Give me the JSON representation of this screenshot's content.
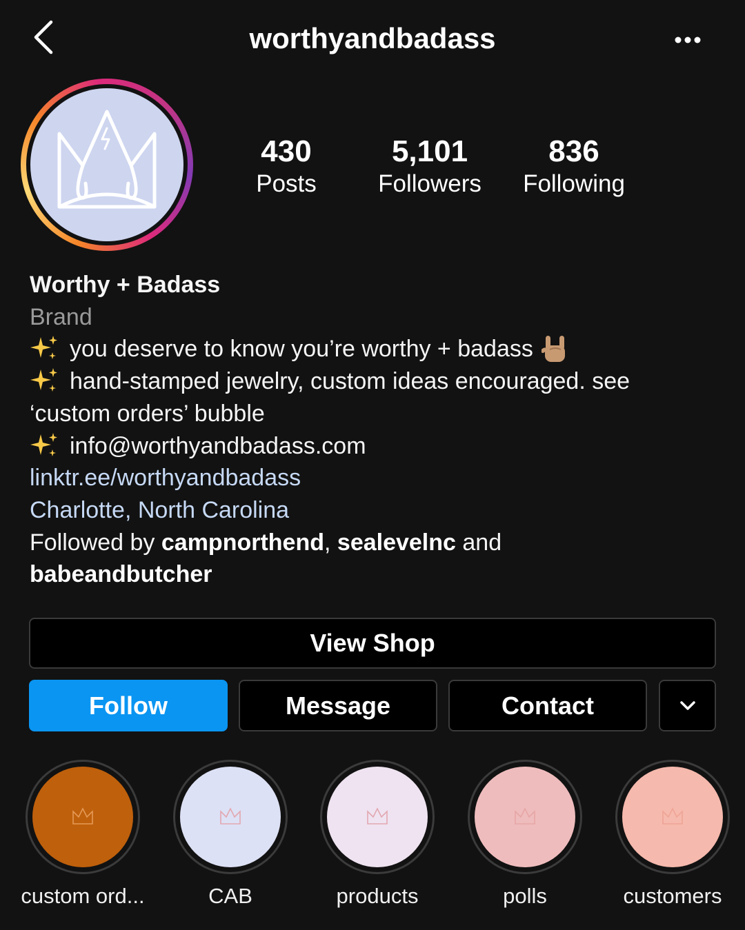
{
  "header": {
    "back_icon": "chevron-left-icon",
    "username": "worthyandbadass",
    "more_icon": "more-horizontal-icon"
  },
  "profile": {
    "avatar_icon": "crown-icon",
    "avatar_bg": "#cdd5ef",
    "stats": [
      {
        "value": "430",
        "label": "Posts"
      },
      {
        "value": "5,101",
        "label": "Followers"
      },
      {
        "value": "836",
        "label": "Following"
      }
    ]
  },
  "bio": {
    "name": "Worthy + Badass",
    "category": "Brand",
    "line1": "you deserve to know you’re worthy + badass",
    "line2a": "hand-stamped jewelry, custom ideas encouraged. see",
    "line2b": "‘custom orders’ bubble",
    "line3": "info@worthyandbadass.com",
    "link": "linktr.ee/worthyandbadass",
    "location": "Charlotte, North Carolina",
    "followed_by_prefix": "Followed by",
    "followed_by_1": "campnorthend",
    "followed_sep": ",",
    "followed_by_2": "sealevelnc",
    "followed_and": "and",
    "followed_by_3": "babeandbutcher",
    "sparkle_icon": "sparkles-icon",
    "rock_icon": "rock-on-hand-icon"
  },
  "actions": {
    "view_shop": "View Shop",
    "follow": "Follow",
    "message": "Message",
    "contact": "Contact",
    "more_icon": "chevron-down-icon",
    "follow_color": "#0a95f2"
  },
  "highlights": [
    {
      "label": "custom ord...",
      "color": "#bf600c"
    },
    {
      "label": "CAB",
      "color": "#dde1f5"
    },
    {
      "label": "products",
      "color": "#efe3f1"
    },
    {
      "label": "polls",
      "color": "#efbcbd"
    },
    {
      "label": "customers",
      "color": "#f6b9ad"
    }
  ]
}
